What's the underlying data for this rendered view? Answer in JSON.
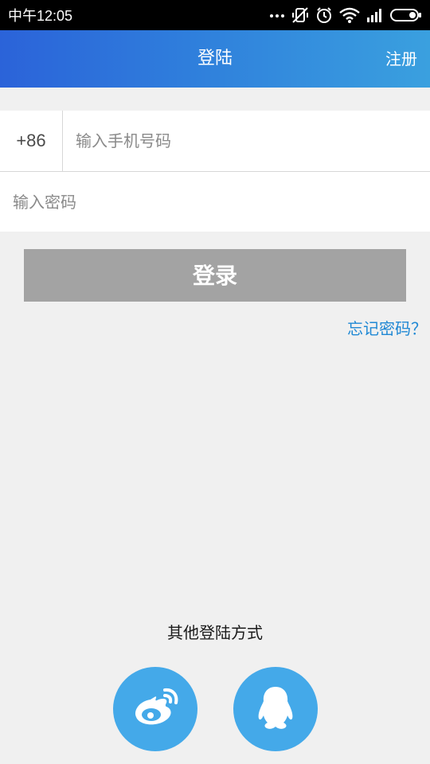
{
  "status_bar": {
    "time": "中午12:05",
    "icons": [
      "more-dots-icon",
      "vibrate-off-icon",
      "alarm-icon",
      "wifi-icon",
      "signal-icon",
      "battery-icon"
    ]
  },
  "app_bar": {
    "title": "登陆",
    "action": "注册",
    "colors": [
      "#2b63d9",
      "#3aa0df"
    ]
  },
  "form": {
    "country_code": "+86",
    "phone_placeholder": "输入手机号码",
    "password_placeholder": "输入密码"
  },
  "login_button": {
    "label": "登录",
    "color": "#a3a3a3"
  },
  "forgot_password": {
    "label": "忘记密码？",
    "color": "#1f88d4"
  },
  "other_login": {
    "label": "其他登陆方式",
    "options": [
      {
        "name": "weibo",
        "icon": "weibo-icon"
      },
      {
        "name": "qq",
        "icon": "qq-icon"
      }
    ],
    "color": "#44a9e9"
  }
}
